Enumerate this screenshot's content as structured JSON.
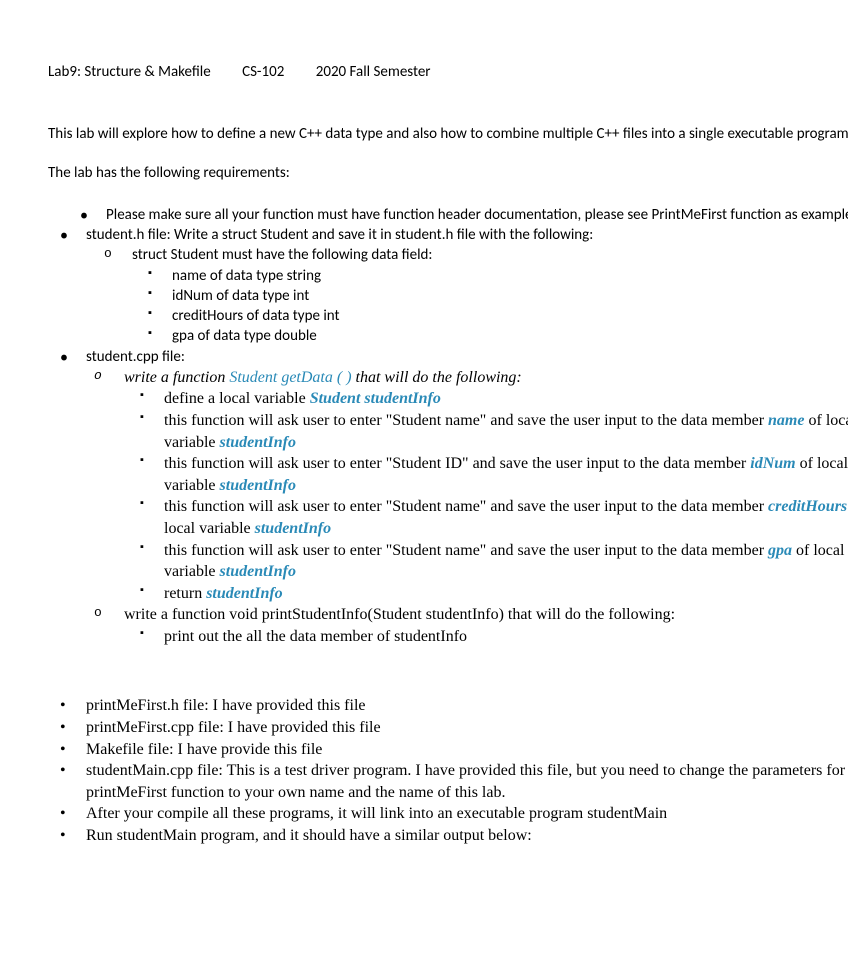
{
  "header": {
    "lab": "Lab9:  Structure & Makefile",
    "course": "CS-102",
    "term": "2020 Fall Semester"
  },
  "intro1": "This lab will explore how to define a new C++ data type and also  how to combine multiple C++ files into a single executable program.",
  "intro2": "The lab has the following requirements:",
  "b1": "Please make sure all your function must have function header documentation, please see PrintMeFirst function as example.",
  "b2": "student.h file: Write a struct Student and save it in student.h file with the following:",
  "b2s1": "struct Student must have the following data field:",
  "b2s1a": "name of data type string",
  "b2s1b": "idNum of data type int",
  "b2s1c": "creditHours of data type int",
  "b2s1d": "gpa of data type double",
  "b3": "student.cpp file:",
  "b3s1_pre": "write a function  ",
  "b3s1_fn": "Student getData ( )",
  "b3s1_post": " that will do the following:",
  "b3s1a_pre": "define a local variable ",
  "b3s1a_var": "Student studentInfo",
  "b3s1b_pre": "this function will ask user to enter \"Student name\" and save the user input to the data member ",
  "b3s1b_mem": "name",
  "b3s1b_mid": " of local variable ",
  "b3s1b_var": "studentInfo",
  "b3s1c_pre": "this function will ask user to enter \"Student ID\" and save the user input to the data member ",
  "b3s1c_mem": "idNum",
  "b3s1c_mid": " of local variable ",
  "b3s1c_var": "studentInfo",
  "b3s1d_pre": "this function will ask user to enter \"Student name\" and save the user input to the data member ",
  "b3s1d_mem": "creditHours",
  "b3s1d_mid": " of local variable ",
  "b3s1d_var": "studentInfo",
  "b3s1e_pre": "this function will ask user to enter \"Student name\" and save the user input to the data member ",
  "b3s1e_mem": "gpa",
  "b3s1e_mid": " of local variable ",
  "b3s1e_var": "studentInfo",
  "b3s1f_pre": "return ",
  "b3s1f_var": "studentInfo",
  "b3s2": "write a function void printStudentInfo(Student studentInfo) that will do the following:",
  "b3s2a": "print out the all the data member of studentInfo",
  "b4": "printMeFirst.h file: I have provided this file",
  "b5": "printMeFirst.cpp file:  I have provided this file",
  "b6": "Makefile file: I have provide this file",
  "b7": "studentMain.cpp file:  This is a test driver program.  I have provided this file, but you need to change the parameters for printMeFirst function to your own name and the name of this lab.",
  "b8": "After your compile all these programs, it will link into an executable program studentMain",
  "b9": "Run studentMain program, and it should have a similar output below:"
}
